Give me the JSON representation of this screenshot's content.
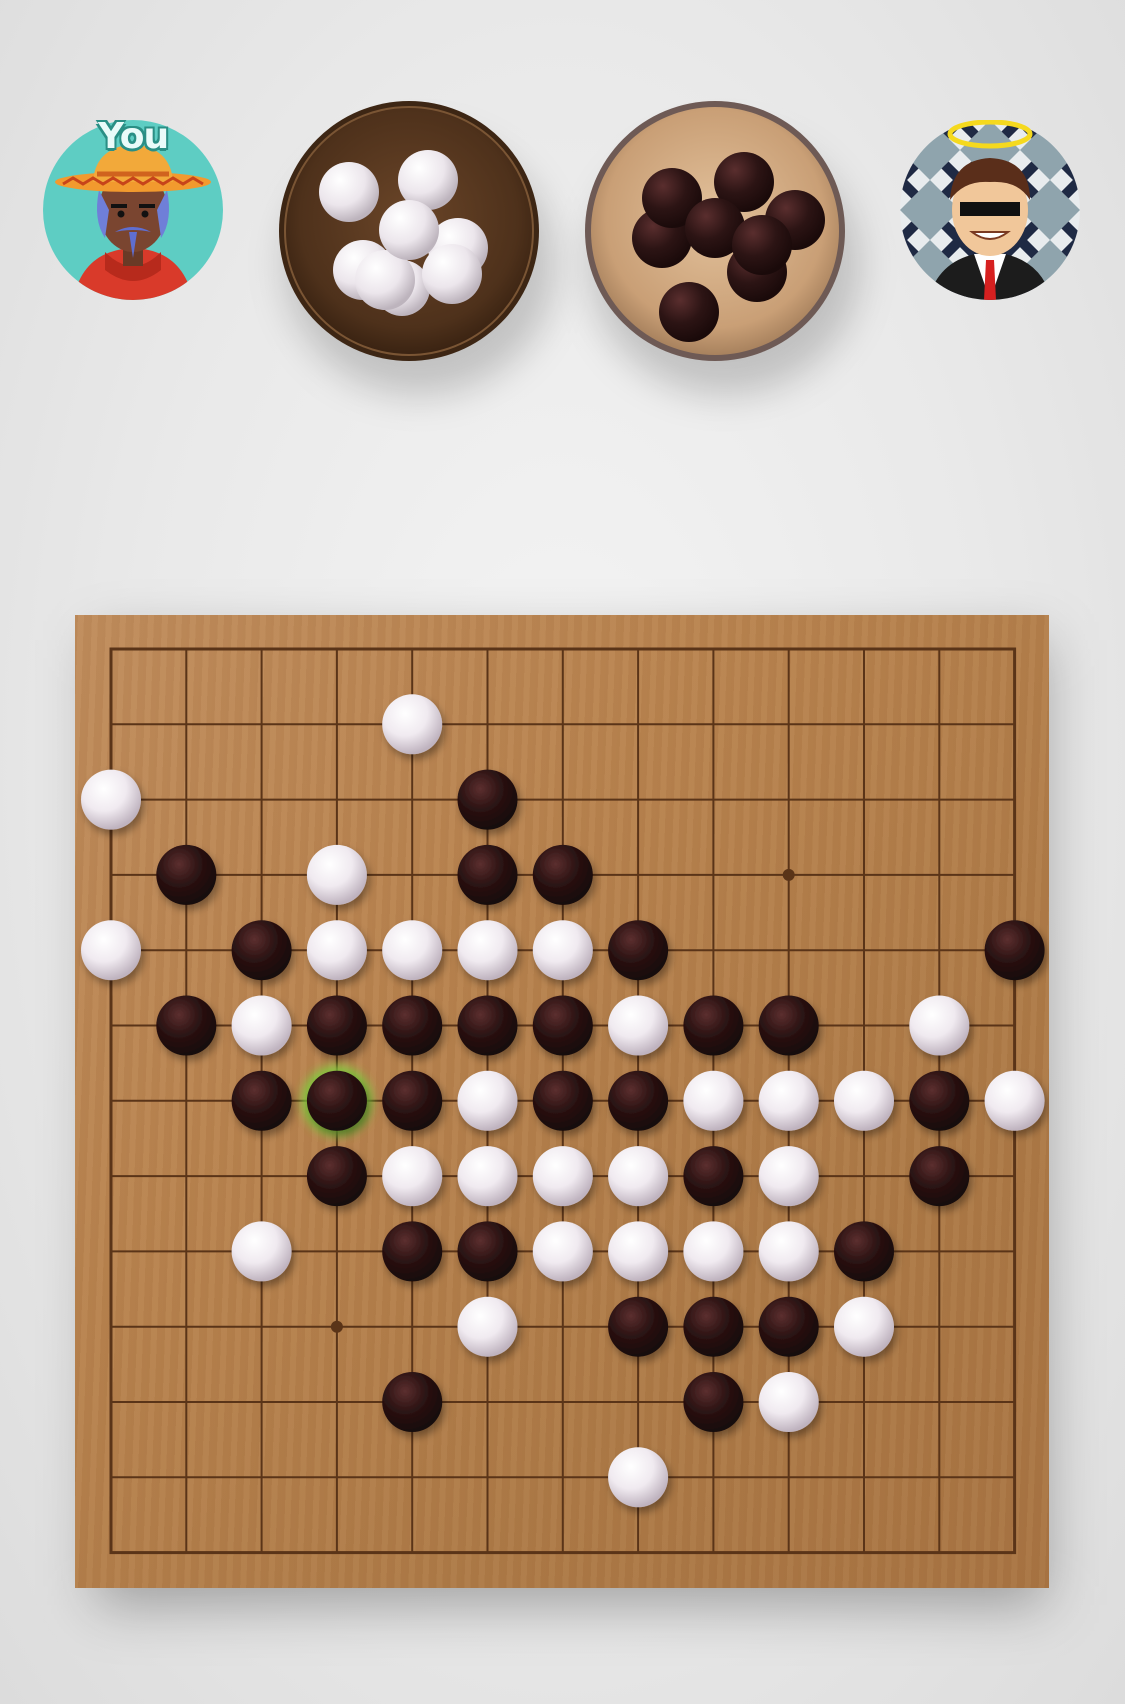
{
  "header": {
    "player_label": "You",
    "player_avatar_icon": "sombrero-man-avatar-icon",
    "opponent_avatar_icon": "angel-sunglasses-man-avatar-icon",
    "player_bowl": {
      "stone_color": "white",
      "icon": "white-stone-bowl-icon"
    },
    "opponent_bowl": {
      "stone_color": "black",
      "icon": "black-stone-bowl-icon"
    }
  },
  "board": {
    "size": 13,
    "star_points": [
      [
        9,
        3
      ],
      [
        3,
        9
      ]
    ],
    "last_move": [
      3,
      6
    ],
    "stones": [
      {
        "c": 4,
        "r": 1,
        "color": "white"
      },
      {
        "c": 0,
        "r": 2,
        "color": "white"
      },
      {
        "c": 5,
        "r": 2,
        "color": "black"
      },
      {
        "c": 1,
        "r": 3,
        "color": "black"
      },
      {
        "c": 3,
        "r": 3,
        "color": "white"
      },
      {
        "c": 5,
        "r": 3,
        "color": "black"
      },
      {
        "c": 6,
        "r": 3,
        "color": "black"
      },
      {
        "c": 0,
        "r": 4,
        "color": "white"
      },
      {
        "c": 2,
        "r": 4,
        "color": "black"
      },
      {
        "c": 3,
        "r": 4,
        "color": "white"
      },
      {
        "c": 4,
        "r": 4,
        "color": "white"
      },
      {
        "c": 5,
        "r": 4,
        "color": "white"
      },
      {
        "c": 6,
        "r": 4,
        "color": "white"
      },
      {
        "c": 7,
        "r": 4,
        "color": "black"
      },
      {
        "c": 12,
        "r": 4,
        "color": "black"
      },
      {
        "c": 1,
        "r": 5,
        "color": "black"
      },
      {
        "c": 2,
        "r": 5,
        "color": "white"
      },
      {
        "c": 3,
        "r": 5,
        "color": "black"
      },
      {
        "c": 4,
        "r": 5,
        "color": "black"
      },
      {
        "c": 5,
        "r": 5,
        "color": "black"
      },
      {
        "c": 6,
        "r": 5,
        "color": "black"
      },
      {
        "c": 7,
        "r": 5,
        "color": "white"
      },
      {
        "c": 8,
        "r": 5,
        "color": "black"
      },
      {
        "c": 9,
        "r": 5,
        "color": "black"
      },
      {
        "c": 11,
        "r": 5,
        "color": "white"
      },
      {
        "c": 2,
        "r": 6,
        "color": "black"
      },
      {
        "c": 3,
        "r": 6,
        "color": "black"
      },
      {
        "c": 4,
        "r": 6,
        "color": "black"
      },
      {
        "c": 5,
        "r": 6,
        "color": "white"
      },
      {
        "c": 6,
        "r": 6,
        "color": "black"
      },
      {
        "c": 7,
        "r": 6,
        "color": "black"
      },
      {
        "c": 8,
        "r": 6,
        "color": "white"
      },
      {
        "c": 9,
        "r": 6,
        "color": "white"
      },
      {
        "c": 10,
        "r": 6,
        "color": "white"
      },
      {
        "c": 11,
        "r": 6,
        "color": "black"
      },
      {
        "c": 12,
        "r": 6,
        "color": "white"
      },
      {
        "c": 3,
        "r": 7,
        "color": "black"
      },
      {
        "c": 4,
        "r": 7,
        "color": "white"
      },
      {
        "c": 5,
        "r": 7,
        "color": "white"
      },
      {
        "c": 6,
        "r": 7,
        "color": "white"
      },
      {
        "c": 7,
        "r": 7,
        "color": "white"
      },
      {
        "c": 8,
        "r": 7,
        "color": "black"
      },
      {
        "c": 9,
        "r": 7,
        "color": "white"
      },
      {
        "c": 11,
        "r": 7,
        "color": "black"
      },
      {
        "c": 2,
        "r": 8,
        "color": "white"
      },
      {
        "c": 4,
        "r": 8,
        "color": "black"
      },
      {
        "c": 5,
        "r": 8,
        "color": "black"
      },
      {
        "c": 6,
        "r": 8,
        "color": "white"
      },
      {
        "c": 7,
        "r": 8,
        "color": "white"
      },
      {
        "c": 8,
        "r": 8,
        "color": "white"
      },
      {
        "c": 9,
        "r": 8,
        "color": "white"
      },
      {
        "c": 10,
        "r": 8,
        "color": "black"
      },
      {
        "c": 5,
        "r": 9,
        "color": "white"
      },
      {
        "c": 7,
        "r": 9,
        "color": "black"
      },
      {
        "c": 8,
        "r": 9,
        "color": "black"
      },
      {
        "c": 9,
        "r": 9,
        "color": "black"
      },
      {
        "c": 10,
        "r": 9,
        "color": "white"
      },
      {
        "c": 4,
        "r": 10,
        "color": "black"
      },
      {
        "c": 8,
        "r": 10,
        "color": "black"
      },
      {
        "c": 9,
        "r": 10,
        "color": "white"
      },
      {
        "c": 7,
        "r": 11,
        "color": "white"
      }
    ]
  },
  "colors": {
    "white_stone": "#f2eef2",
    "black_stone": "#2a1414",
    "grid_line": "#5a3418",
    "last_move_glow": "#7fd23c"
  }
}
